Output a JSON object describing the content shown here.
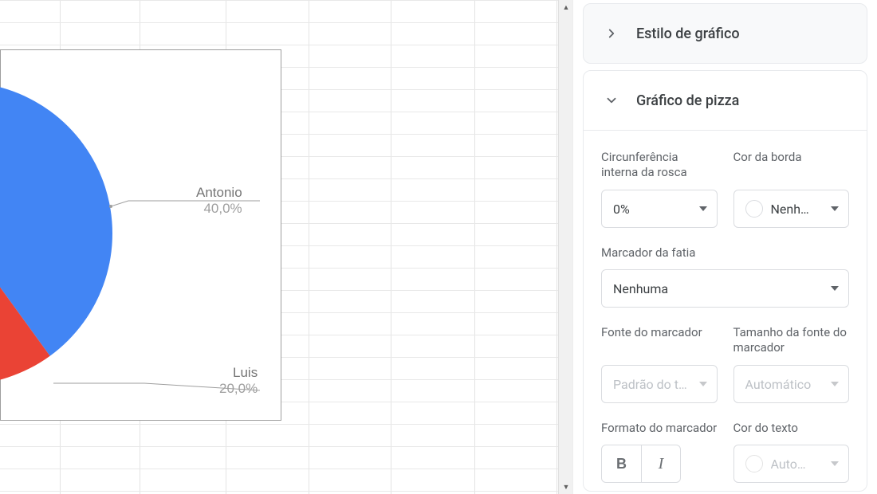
{
  "chart_data": {
    "type": "pie",
    "labels": [
      "Antonio",
      "Luis"
    ],
    "values": [
      40.0,
      20.0
    ],
    "value_format": "percent_1dec_comma",
    "slice_colors": [
      "#4285f4",
      "#ea4335"
    ],
    "display_labels": [
      "Antonio",
      "Luis"
    ],
    "display_values": [
      "40,0%",
      "20,0%"
    ]
  },
  "panel": {
    "sections": {
      "chart_style": {
        "title": "Estilo de gráfico",
        "expanded": false
      },
      "pie": {
        "title": "Gráfico de pizza",
        "expanded": true
      }
    },
    "fields": {
      "donut_hole": {
        "label": "Circunferência interna da rosca",
        "value": "0%"
      },
      "border_color": {
        "label": "Cor da borda",
        "value": "Nenh…",
        "swatch": "#ffffff"
      },
      "slice_label": {
        "label": "Marcador da fatia",
        "value": "Nenhuma"
      },
      "label_font": {
        "label": "Fonte do marcador",
        "value": "Padrão do te…",
        "disabled": true
      },
      "label_font_size": {
        "label": "Tamanho da fonte do marcador",
        "value": "Automático",
        "disabled": true
      },
      "label_format": {
        "label": "Formato do marcador"
      },
      "text_color": {
        "label": "Cor do texto",
        "value": "Auto…",
        "disabled": true
      }
    }
  }
}
